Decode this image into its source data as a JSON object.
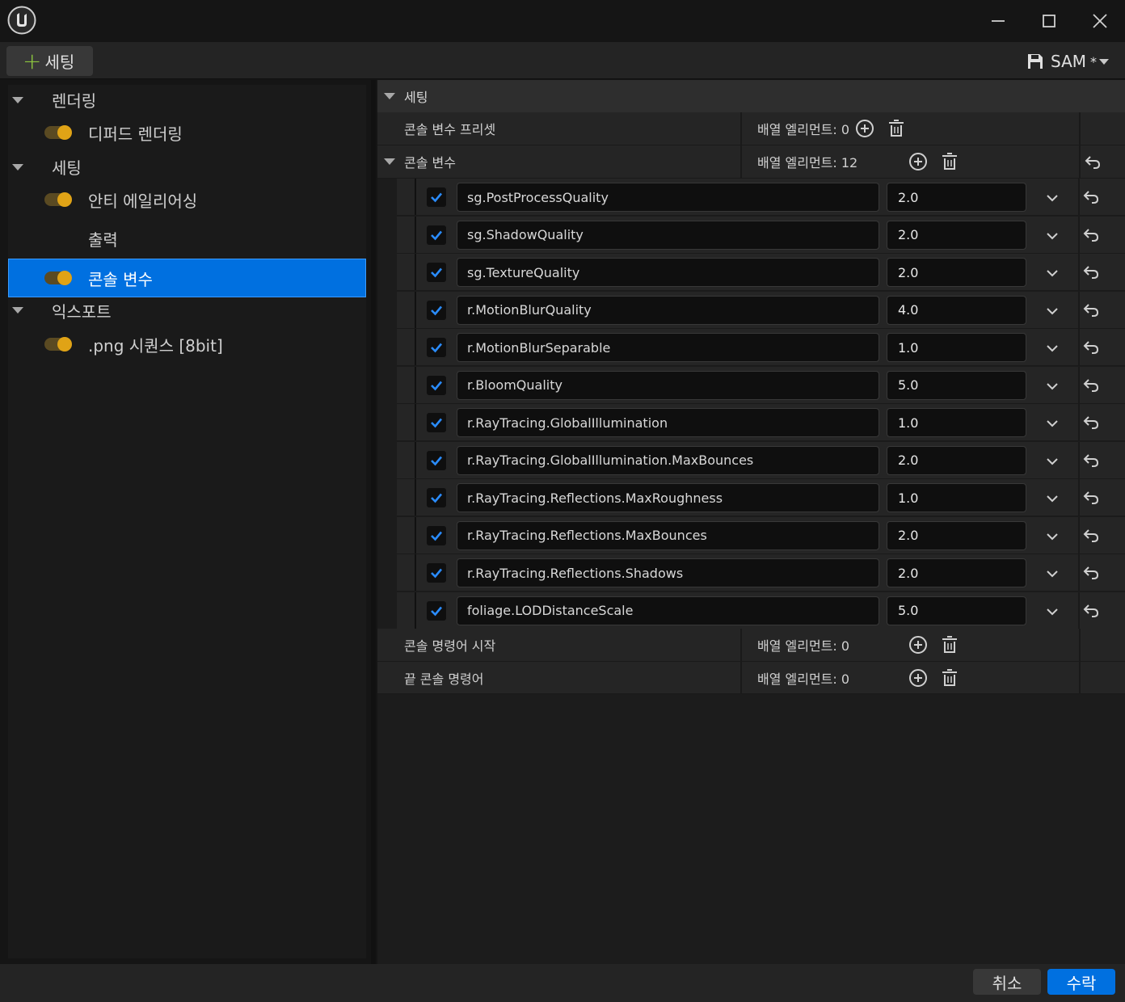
{
  "window": {
    "title_icon": "unreal-engine-logo-icon",
    "minimize_icon": "minimize-icon",
    "maximize_icon": "maximize-icon",
    "close_icon": "close-icon"
  },
  "toolbar": {
    "add_setting_label": "세팅",
    "preset_label": "SAM",
    "preset_dirty_marker": "*"
  },
  "tree": {
    "items": [
      {
        "label": "렌더링",
        "type": "category"
      },
      {
        "label": "디퍼드 렌더링",
        "type": "setting",
        "enabled": true
      },
      {
        "label": "세팅",
        "type": "category"
      },
      {
        "label": "안티 에일리어싱",
        "type": "setting",
        "enabled": true
      },
      {
        "label": "출력",
        "type": "setting"
      },
      {
        "label": "콘솔 변수",
        "type": "setting",
        "enabled": true,
        "selected": true
      },
      {
        "label": "익스포트",
        "type": "category"
      },
      {
        "label": ".png 시퀀스 [8bit]",
        "type": "setting",
        "enabled": true
      }
    ]
  },
  "details": {
    "section_title": "세팅",
    "preset_row": {
      "label": "콘솔 변수 프리셋",
      "value": "배열 엘리먼트: 0"
    },
    "cvars_row": {
      "label": "콘솔 변수",
      "value": "배열 엘리먼트: 12"
    },
    "cvars": [
      {
        "name": "sg.PostProcessQuality",
        "value": "2.0",
        "enabled": true
      },
      {
        "name": "sg.ShadowQuality",
        "value": "2.0",
        "enabled": true
      },
      {
        "name": "sg.TextureQuality",
        "value": "2.0",
        "enabled": true
      },
      {
        "name": "r.MotionBlurQuality",
        "value": "4.0",
        "enabled": true
      },
      {
        "name": "r.MotionBlurSeparable",
        "value": "1.0",
        "enabled": true
      },
      {
        "name": "r.BloomQuality",
        "value": "5.0",
        "enabled": true
      },
      {
        "name": "r.RayTracing.GlobalIllumination",
        "value": "1.0",
        "enabled": true
      },
      {
        "name": "r.RayTracing.GlobalIllumination.MaxBounces",
        "value": "2.0",
        "enabled": true
      },
      {
        "name": "r.RayTracing.Reflections.MaxRoughness",
        "value": "1.0",
        "enabled": true
      },
      {
        "name": "r.RayTracing.Reflections.MaxBounces",
        "value": "2.0",
        "enabled": true
      },
      {
        "name": "r.RayTracing.Reflections.Shadows",
        "value": "2.0",
        "enabled": true
      },
      {
        "name": "foliage.LODDistanceScale",
        "value": "5.0",
        "enabled": true
      }
    ],
    "start_cmds_row": {
      "label": "콘솔 명령어 시작",
      "value": "배열 엘리먼트: 0"
    },
    "end_cmds_row": {
      "label": "끝 콘솔 명령어",
      "value": "배열 엘리먼트: 0"
    }
  },
  "footer": {
    "cancel_label": "취소",
    "accept_label": "수락"
  },
  "colors": {
    "accent": "#0070e0",
    "toggle_on": "#e0a316",
    "add_green": "#8cc63f",
    "check_blue": "#2a8cff"
  }
}
